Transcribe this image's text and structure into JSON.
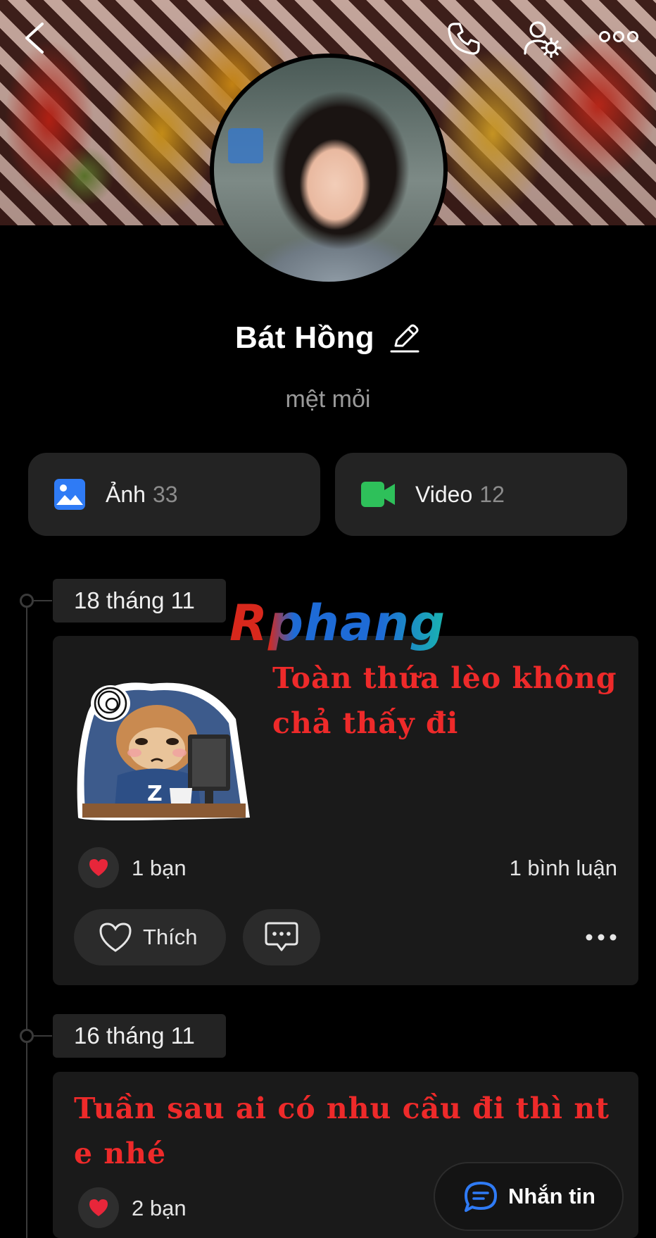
{
  "header": {
    "back_icon": "chevron-left-icon",
    "call_icon": "phone-icon",
    "settings_icon": "profile-settings-icon",
    "more_icon": "more-horizontal-icon"
  },
  "profile": {
    "name": "Bát Hồng",
    "bio": "mệt mỏi"
  },
  "media": {
    "photos": {
      "label": "Ảnh",
      "count": "33",
      "color": "#2f7bf5"
    },
    "videos": {
      "label": "Video",
      "count": "12",
      "color": "#2ec05a"
    }
  },
  "watermark": "Rphang",
  "posts": [
    {
      "date": "18 tháng 11",
      "text": "Toàn thứa lèo không chả thấy đi",
      "reactions": "1 bạn",
      "comments": "1 bình luận",
      "like_label": "Thích"
    },
    {
      "date": "16 tháng 11",
      "text": "Tuần sau ai có nhu cầu đi thì nt e nhé",
      "reactions": "2 bạn"
    }
  ],
  "actions": {
    "message_label": "Nhắn tin"
  },
  "colors": {
    "post_text": "#ee2a2a",
    "heart": "#e8263a",
    "message_icon": "#2f7bf5"
  }
}
